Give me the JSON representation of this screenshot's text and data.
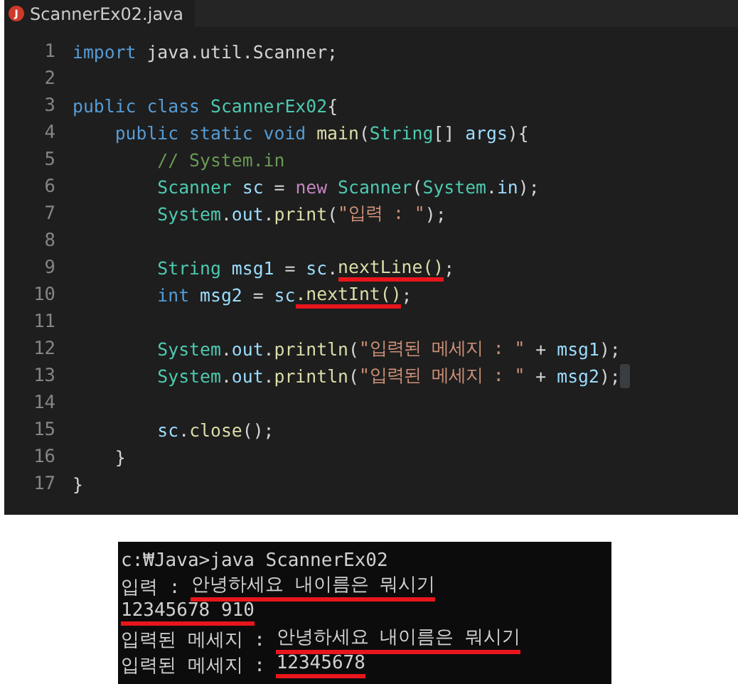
{
  "editor": {
    "tab": {
      "icon": "J",
      "title": "ScannerEx02.java",
      "selected": true
    },
    "lines": [
      {
        "number": "1",
        "tokens": [
          {
            "kind": "keyword",
            "text": "import"
          },
          {
            "kind": "plain",
            "text": " java.util.Scanner;"
          }
        ]
      },
      {
        "number": "2"
      },
      {
        "number": "3",
        "tokens": [
          {
            "kind": "keyword",
            "text": "public class"
          },
          {
            "kind": "type",
            "text": " ScannerEx02"
          },
          {
            "kind": "plain",
            "text": "{"
          }
        ]
      },
      {
        "number": "4",
        "tokens": [
          {
            "kind": "keyword",
            "text": "    public static void"
          },
          {
            "kind": "method",
            "text": " main"
          },
          {
            "kind": "plain",
            "text": "("
          },
          {
            "kind": "type",
            "text": "String"
          },
          {
            "kind": "plain",
            "text": "[] "
          },
          {
            "kind": "variable",
            "text": "args"
          },
          {
            "kind": "plain",
            "text": "){"
          }
        ]
      },
      {
        "number": "5",
        "tokens": [
          {
            "kind": "comment",
            "text": "        // System.in"
          }
        ]
      },
      {
        "number": "6",
        "tokens": [
          {
            "kind": "type",
            "text": "        Scanner"
          },
          {
            "kind": "variable",
            "text": " sc"
          },
          {
            "kind": "plain",
            "text": " = "
          },
          {
            "kind": "control",
            "text": "new"
          },
          {
            "kind": "type",
            "text": " Scanner"
          },
          {
            "kind": "plain",
            "text": "("
          },
          {
            "kind": "type",
            "text": "System"
          },
          {
            "kind": "plain",
            "text": "."
          },
          {
            "kind": "variable",
            "text": "in"
          },
          {
            "kind": "plain",
            "text": ");"
          }
        ]
      },
      {
        "number": "7",
        "tokens": [
          {
            "kind": "type",
            "text": "        System"
          },
          {
            "kind": "plain",
            "text": "."
          },
          {
            "kind": "variable",
            "text": "out"
          },
          {
            "kind": "plain",
            "text": "."
          },
          {
            "kind": "method",
            "text": "print"
          },
          {
            "kind": "plain",
            "text": "("
          },
          {
            "kind": "string",
            "text": "\"입력 : \""
          },
          {
            "kind": "plain",
            "text": ");"
          }
        ]
      },
      {
        "number": "8"
      },
      {
        "number": "9",
        "tokens": [
          {
            "kind": "type",
            "text": "        String"
          },
          {
            "kind": "variable",
            "text": " msg1"
          },
          {
            "kind": "plain",
            "text": " = "
          },
          {
            "kind": "variable",
            "text": "sc"
          },
          {
            "kind": "plain",
            "text": "."
          },
          {
            "kind": "method",
            "text": "nextLine()",
            "underlined": true
          },
          {
            "kind": "plain",
            "text": ";"
          }
        ]
      },
      {
        "number": "10",
        "tokens": [
          {
            "kind": "keyword",
            "text": "        int"
          },
          {
            "kind": "variable",
            "text": " msg2"
          },
          {
            "kind": "plain",
            "text": " = "
          },
          {
            "kind": "variable",
            "text": "sc"
          },
          {
            "kind": "method",
            "text": ".nextInt()",
            "underlined": true
          },
          {
            "kind": "plain",
            "text": ";"
          }
        ]
      },
      {
        "number": "11"
      },
      {
        "number": "12",
        "tokens": [
          {
            "kind": "type",
            "text": "        System"
          },
          {
            "kind": "plain",
            "text": "."
          },
          {
            "kind": "variable",
            "text": "out"
          },
          {
            "kind": "plain",
            "text": "."
          },
          {
            "kind": "method",
            "text": "println"
          },
          {
            "kind": "plain",
            "text": "("
          },
          {
            "kind": "string",
            "text": "\"입력된 메세지 : \""
          },
          {
            "kind": "plain",
            "text": " + "
          },
          {
            "kind": "variable",
            "text": "msg1"
          },
          {
            "kind": "plain",
            "text": ");"
          }
        ]
      },
      {
        "number": "13",
        "cursor": true,
        "tokens": [
          {
            "kind": "type",
            "text": "        System"
          },
          {
            "kind": "plain",
            "text": "."
          },
          {
            "kind": "variable",
            "text": "out"
          },
          {
            "kind": "plain",
            "text": "."
          },
          {
            "kind": "method",
            "text": "println"
          },
          {
            "kind": "plain",
            "text": "("
          },
          {
            "kind": "string",
            "text": "\"입력된 메세지 : \""
          },
          {
            "kind": "plain",
            "text": " + "
          },
          {
            "kind": "variable",
            "text": "msg2"
          },
          {
            "kind": "plain",
            "text": ");"
          }
        ]
      },
      {
        "number": "14"
      },
      {
        "number": "15",
        "tokens": [
          {
            "kind": "variable",
            "text": "        sc"
          },
          {
            "kind": "plain",
            "text": "."
          },
          {
            "kind": "method",
            "text": "close"
          },
          {
            "kind": "plain",
            "text": "();"
          }
        ]
      },
      {
        "number": "16",
        "tokens": [
          {
            "kind": "plain",
            "text": "    }"
          }
        ]
      },
      {
        "number": "17",
        "tokens": [
          {
            "kind": "plain",
            "text": "}"
          }
        ]
      }
    ]
  },
  "console": {
    "lines": [
      [
        {
          "text": "c:₩Java>java ScannerEx02"
        }
      ],
      [
        {
          "text": "입력 : "
        },
        {
          "text": "안녕하세요 내이름은 뭐시기",
          "underlined": true
        }
      ],
      [
        {
          "text": "12345678 910",
          "underlined": true
        }
      ],
      [
        {
          "text": "입력된 메세지 : "
        },
        {
          "text": "안녕하세요 내이름은 뭐시기",
          "underlined": true
        }
      ],
      [
        {
          "text": "입력된 메세지 : "
        },
        {
          "text": "12345678",
          "underlined": true
        }
      ]
    ]
  }
}
